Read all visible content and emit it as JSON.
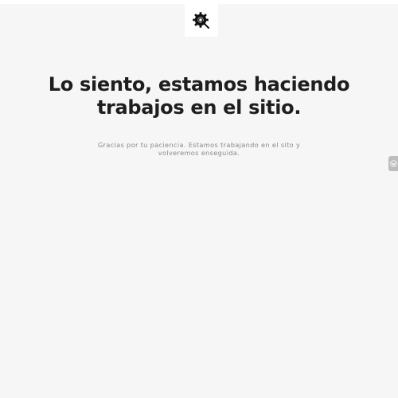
{
  "header": {
    "logo_icon": "gear-search-icon"
  },
  "main": {
    "headline": "Lo siento, estamos haciendo trabajos en el sitio.",
    "subtext": "Gracias por tu paciencia. Estamos trabajando en el sito y volveremos enseguida."
  },
  "side_tab": {
    "icon": "wordpress-icon"
  },
  "colors": {
    "background": "#f6f6f6",
    "headline": "#1e1e1e",
    "subtext": "#8a8a8a",
    "panel": "#ffffff",
    "tab": "#bdbdbd"
  }
}
